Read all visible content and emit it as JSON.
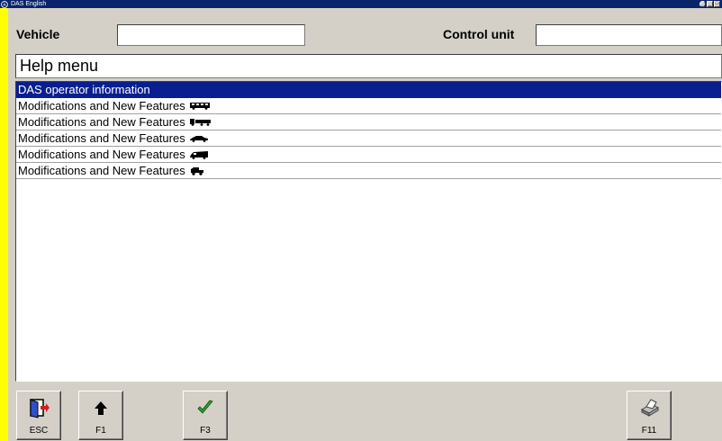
{
  "window": {
    "title": "DAS English",
    "controls": [
      "help",
      "minimize",
      "maximize"
    ]
  },
  "header": {
    "vehicle_label": "Vehicle",
    "vehicle_value": "",
    "control_unit_label": "Control unit",
    "control_unit_value": ""
  },
  "page": {
    "title": "Help menu"
  },
  "menu": {
    "items": [
      {
        "label": "DAS operator information",
        "icon": "",
        "selected": true
      },
      {
        "label": "Modifications and New Features",
        "icon": "bus-icon",
        "selected": false
      },
      {
        "label": "Modifications and New Features",
        "icon": "truck-icon",
        "selected": false
      },
      {
        "label": "Modifications and New Features",
        "icon": "car-icon",
        "selected": false
      },
      {
        "label": "Modifications and New Features",
        "icon": "van-icon",
        "selected": false
      },
      {
        "label": "Modifications and New Features",
        "icon": "offroad-icon",
        "selected": false
      }
    ]
  },
  "toolbar": {
    "esc_label": "ESC",
    "f1_label": "F1",
    "f3_label": "F3",
    "f11_label": "F11"
  },
  "colors": {
    "desktop": "#ffff00",
    "panel": "#d4d0c8",
    "selection": "#0a1f8f",
    "titlebar": "#0a246a"
  }
}
